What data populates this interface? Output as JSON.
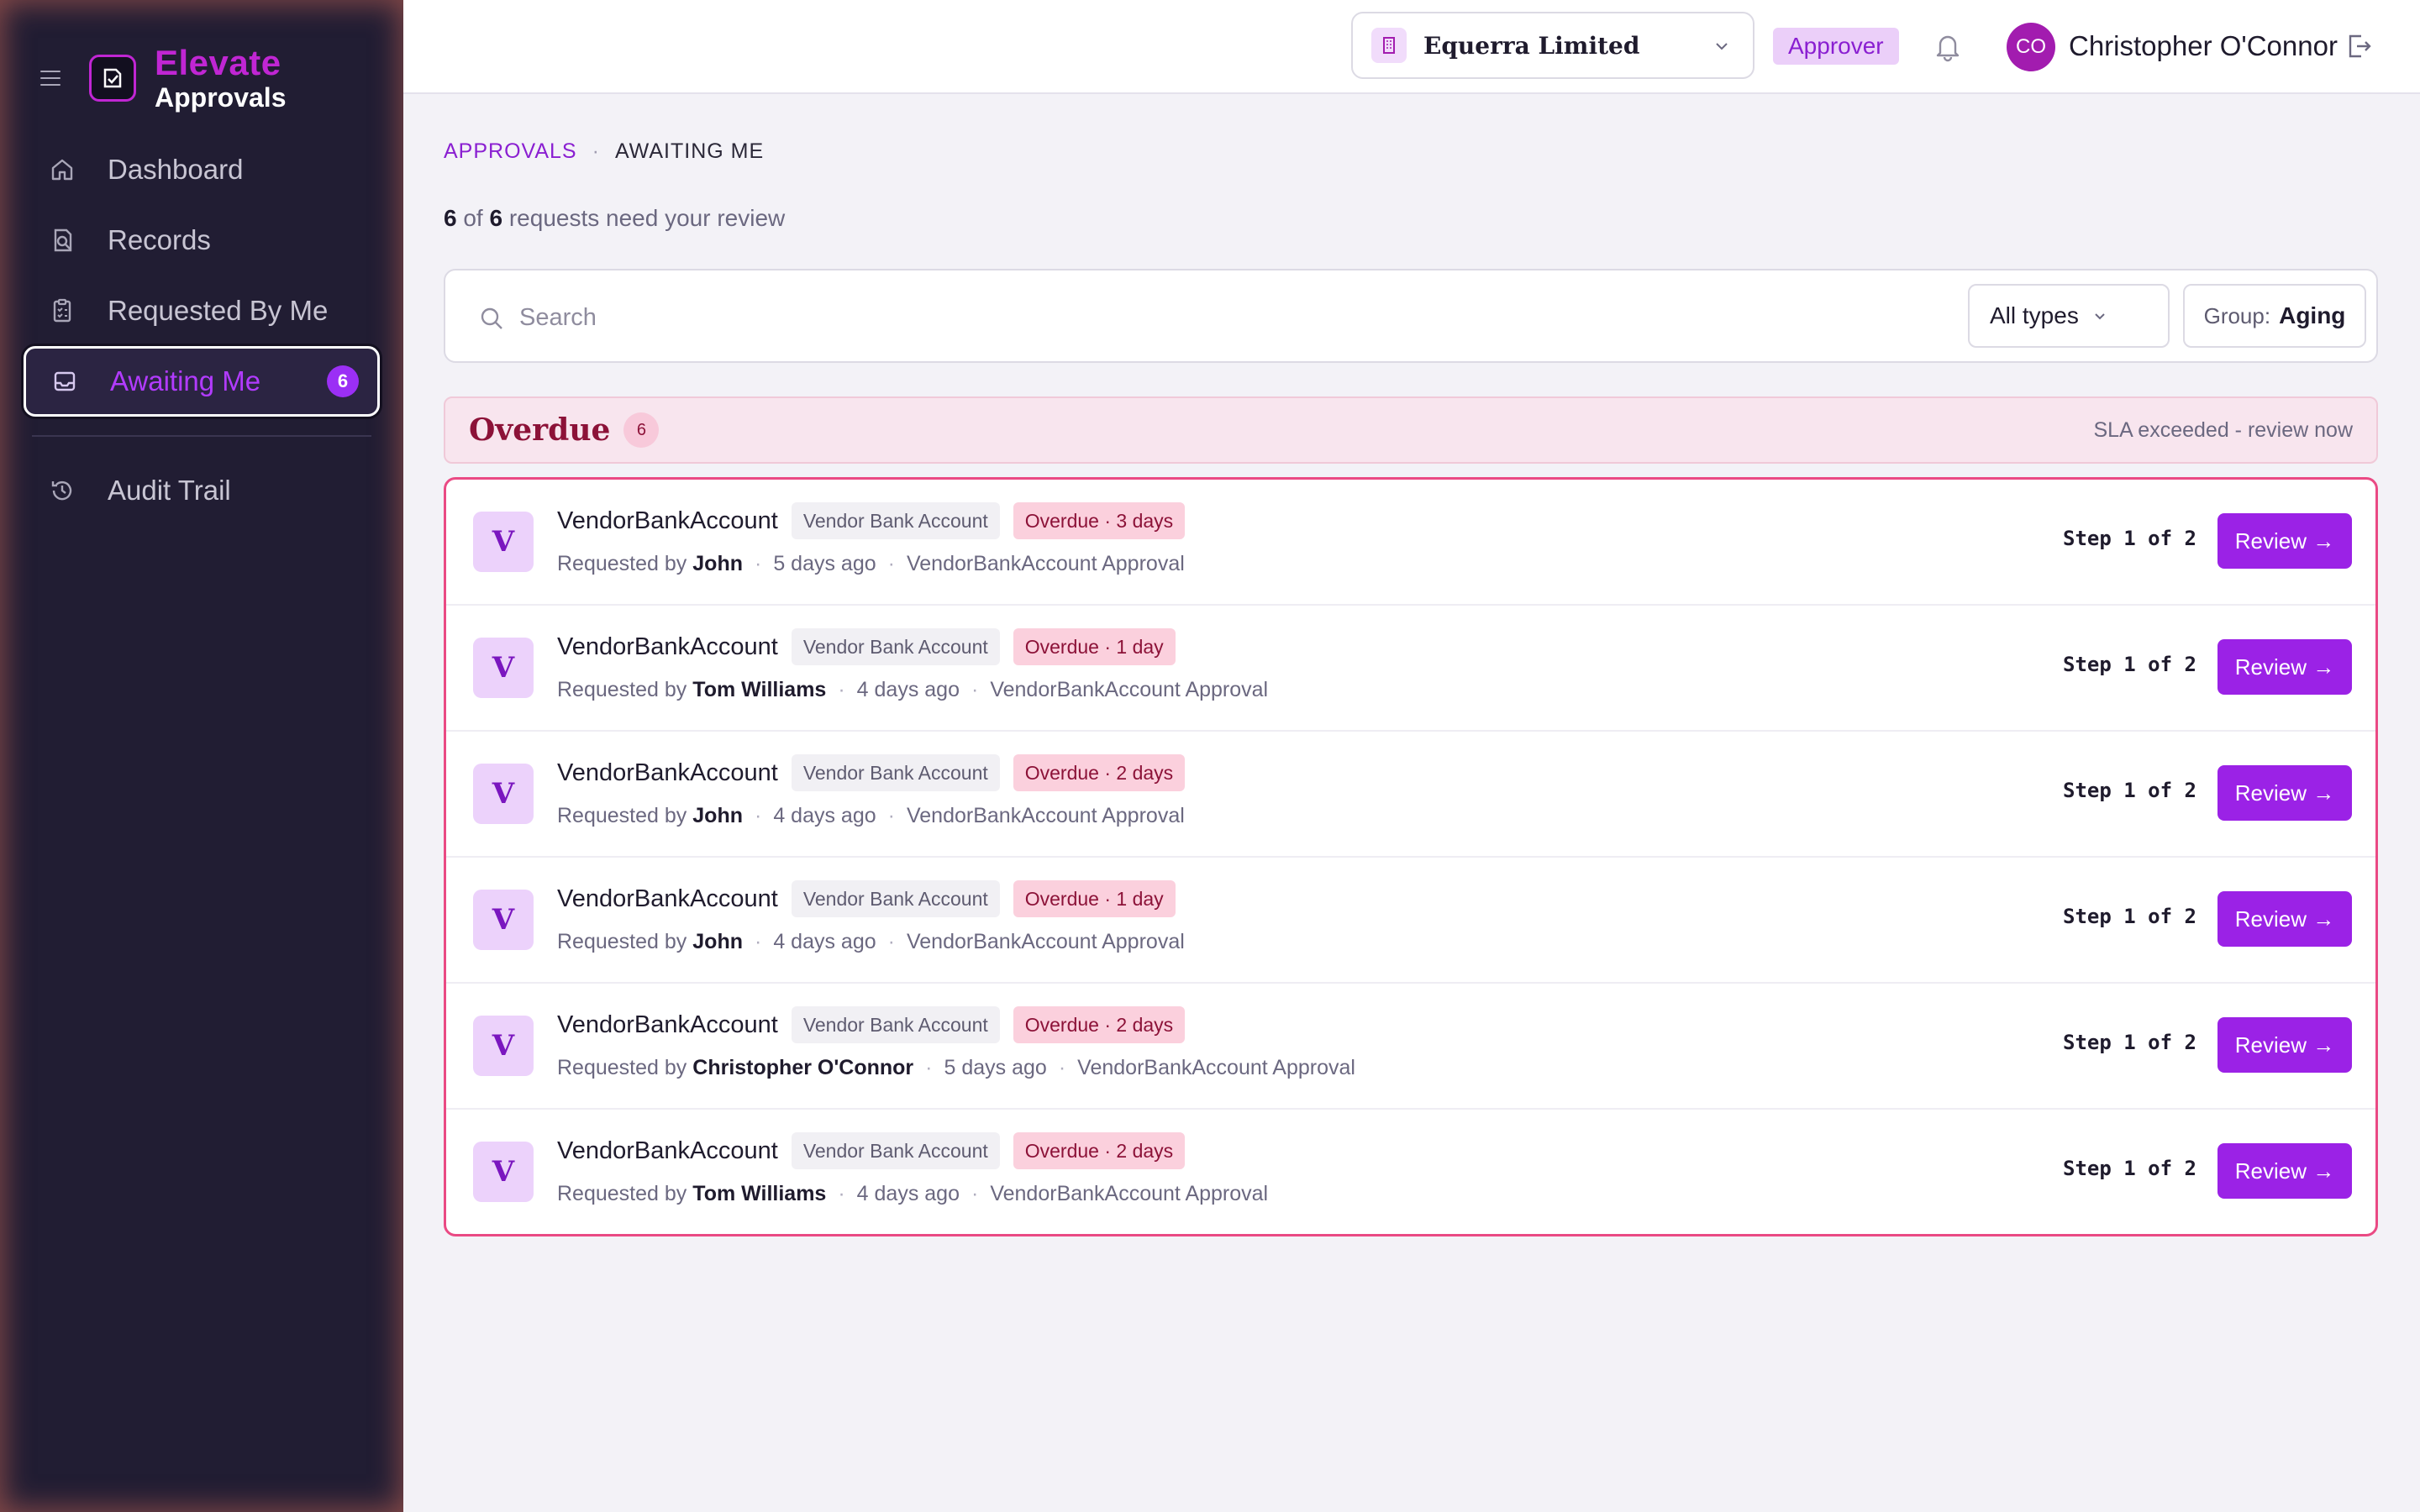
{
  "brand": {
    "name": "Elevate",
    "subtitle": "Approvals"
  },
  "sidebar": {
    "items": [
      {
        "label": "Dashboard",
        "icon": "home-icon"
      },
      {
        "label": "Records",
        "icon": "records-search-icon"
      },
      {
        "label": "Requested By Me",
        "icon": "clipboard-list-icon"
      },
      {
        "label": "Awaiting Me",
        "icon": "inbox-icon",
        "badge": "6",
        "active": true
      },
      {
        "label": "Audit Trail",
        "icon": "history-icon"
      }
    ]
  },
  "header": {
    "org": "Equerra Limited",
    "role": "Approver",
    "user_initials": "CO",
    "user_name": "Christopher O'Connor"
  },
  "breadcrumb": {
    "root": "APPROVALS",
    "separator": "·",
    "current": "AWAITING ME"
  },
  "summary": {
    "shown": "6",
    "of": "of",
    "total": "6",
    "text": "requests need your review"
  },
  "filters": {
    "search_placeholder": "Search",
    "type": "All types",
    "group_label": "Group:",
    "group_value": "Aging"
  },
  "group": {
    "title": "Overdue",
    "count": "6",
    "note": "SLA exceeded - review now"
  },
  "rows": [
    {
      "avatar": "V",
      "title": "VendorBankAccount",
      "type": "Vendor Bank Account",
      "overdue": "Overdue · 3 days",
      "requested_by": "Requested by",
      "requester": "John",
      "age": "5 days ago",
      "workflow": "VendorBankAccount Approval",
      "step": "Step 1 of 2",
      "action": "Review →"
    },
    {
      "avatar": "V",
      "title": "VendorBankAccount",
      "type": "Vendor Bank Account",
      "overdue": "Overdue · 1 day",
      "requested_by": "Requested by",
      "requester": "Tom Williams",
      "age": "4 days ago",
      "workflow": "VendorBankAccount Approval",
      "step": "Step 1 of 2",
      "action": "Review →"
    },
    {
      "avatar": "V",
      "title": "VendorBankAccount",
      "type": "Vendor Bank Account",
      "overdue": "Overdue · 2 days",
      "requested_by": "Requested by",
      "requester": "John",
      "age": "4 days ago",
      "workflow": "VendorBankAccount Approval",
      "step": "Step 1 of 2",
      "action": "Review →"
    },
    {
      "avatar": "V",
      "title": "VendorBankAccount",
      "type": "Vendor Bank Account",
      "overdue": "Overdue · 1 day",
      "requested_by": "Requested by",
      "requester": "John",
      "age": "4 days ago",
      "workflow": "VendorBankAccount Approval",
      "step": "Step 1 of 2",
      "action": "Review →"
    },
    {
      "avatar": "V",
      "title": "VendorBankAccount",
      "type": "Vendor Bank Account",
      "overdue": "Overdue · 2 days",
      "requested_by": "Requested by",
      "requester": "Christopher O'Connor",
      "age": "5 days ago",
      "workflow": "VendorBankAccount Approval",
      "step": "Step 1 of 2",
      "action": "Review →"
    },
    {
      "avatar": "V",
      "title": "VendorBankAccount",
      "type": "Vendor Bank Account",
      "overdue": "Overdue · 2 days",
      "requested_by": "Requested by",
      "requester": "Tom Williams",
      "age": "4 days ago",
      "workflow": "VendorBankAccount Approval",
      "step": "Step 1 of 2",
      "action": "Review →"
    }
  ],
  "colors": {
    "sidebar_bg": "#211d33",
    "accent": "#9b22e6",
    "brand": "#c026d3",
    "overdue_text": "#8c1238",
    "overdue_border": "#ea4a84"
  }
}
